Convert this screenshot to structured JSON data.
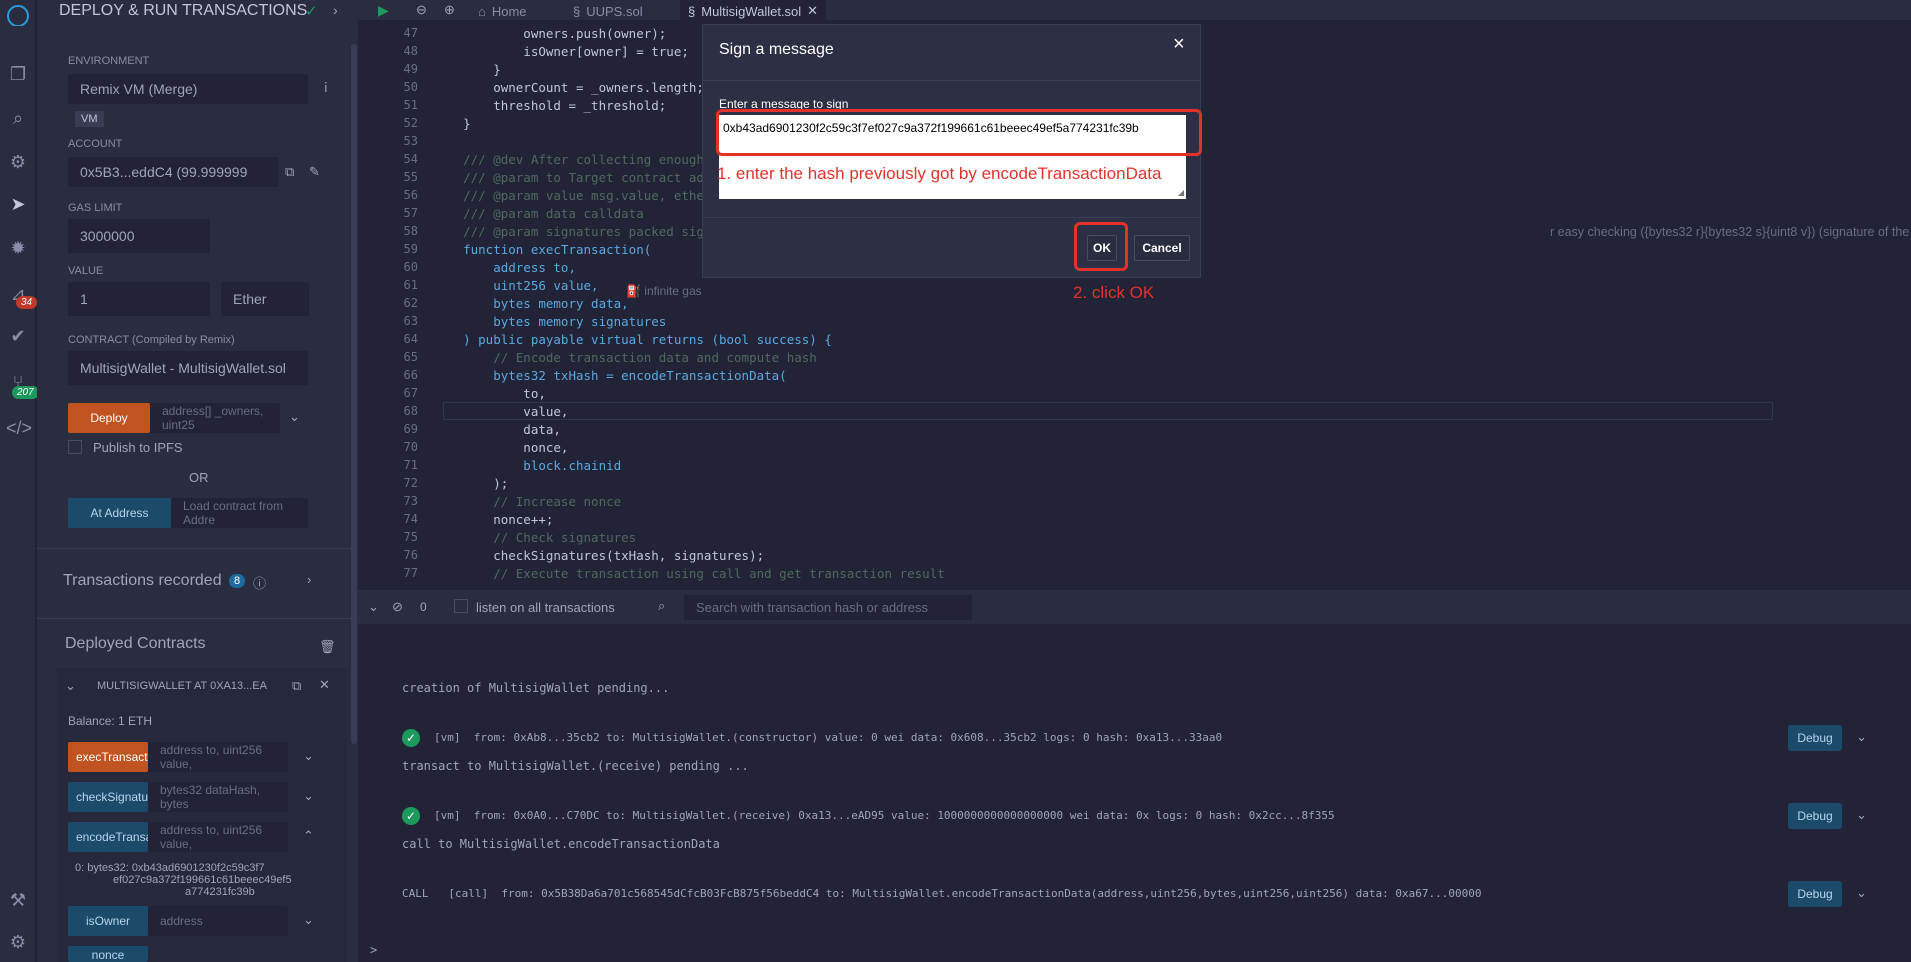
{
  "sidebar": {
    "title": "DEPLOY & RUN TRANSACTIONS",
    "badge_34": "34",
    "badge_207": "207"
  },
  "panel": {
    "environment_label": "ENVIRONMENT",
    "environment_value": "Remix VM (Merge)",
    "vm_tag": "VM",
    "account_label": "ACCOUNT",
    "account_value": "0x5B3...eddC4 (99.999999",
    "gas_limit_label": "GAS LIMIT",
    "gas_limit_value": "3000000",
    "value_label": "VALUE",
    "value_amount": "1",
    "value_unit": "Ether",
    "contract_label": "CONTRACT (Compiled by Remix)",
    "contract_value": "MultisigWallet - MultisigWallet.sol",
    "deploy_label": "Deploy",
    "deploy_params": "address[] _owners, uint25",
    "publish_ipfs": "Publish to IPFS",
    "or_text": "OR",
    "at_address_label": "At Address",
    "at_address_placeholder": "Load contract from Addre",
    "transactions_recorded": "Transactions recorded",
    "transactions_count": "8",
    "deployed_contracts": "Deployed Contracts",
    "instance_name": "MULTISIGWALLET AT 0XA13...EA",
    "balance": "Balance: 1 ETH",
    "functions": [
      {
        "name": "execTransact",
        "params": "address to, uint256 value,"
      },
      {
        "name": "checkSignatu",
        "params": "bytes32 dataHash, bytes"
      },
      {
        "name": "encodeTransa",
        "params": "address to, uint256 value,"
      }
    ],
    "output_line1": "0:  bytes32: 0xb43ad6901230f2c59c3f7",
    "output_line2": "ef027c9a372f199661c61beeec49ef5",
    "output_line3": "a774231fc39b",
    "is_owner_label": "isOwner",
    "is_owner_param": "address",
    "nonce_label": "nonce"
  },
  "tabs": {
    "home": "Home",
    "uups": "UUPS.sol",
    "multisig": "MultisigWallet.sol"
  },
  "code": [
    {
      "n": "47",
      "t": "            owners.push(owner);"
    },
    {
      "n": "48",
      "t": "            isOwner[owner] = true;"
    },
    {
      "n": "49",
      "t": "        }"
    },
    {
      "n": "50",
      "t": "        ownerCount = _owners.length;"
    },
    {
      "n": "51",
      "t": "        threshold = _threshold;"
    },
    {
      "n": "52",
      "t": "    }"
    },
    {
      "n": "53",
      "t": ""
    },
    {
      "n": "54",
      "t": "    /// @dev After collecting enough"
    },
    {
      "n": "55",
      "t": "    /// @param to Target contract ad"
    },
    {
      "n": "56",
      "t": "    /// @param value msg.value, ethe"
    },
    {
      "n": "57",
      "t": "    /// @param data calldata"
    },
    {
      "n": "58",
      "t": "    /// @param signatures packed sig"
    },
    {
      "n": "59",
      "t": "    function execTransaction("
    },
    {
      "n": "60",
      "t": "        address to,"
    },
    {
      "n": "61",
      "t": "        uint256 value,"
    },
    {
      "n": "62",
      "t": "        bytes memory data,"
    },
    {
      "n": "63",
      "t": "        bytes memory signatures"
    },
    {
      "n": "64",
      "t": "    ) public payable virtual returns (bool success) {"
    },
    {
      "n": "65",
      "t": "        // Encode transaction data and compute hash"
    },
    {
      "n": "66",
      "t": "        bytes32 txHash = encodeTransactionData("
    },
    {
      "n": "67",
      "t": "            to,"
    },
    {
      "n": "68",
      "t": "            value,"
    },
    {
      "n": "69",
      "t": "            data,"
    },
    {
      "n": "70",
      "t": "            nonce,"
    },
    {
      "n": "71",
      "t": "            block.chainid"
    },
    {
      "n": "72",
      "t": "        );"
    },
    {
      "n": "73",
      "t": "        // Increase nonce"
    },
    {
      "n": "74",
      "t": "        nonce++;"
    },
    {
      "n": "75",
      "t": "        // Check signatures"
    },
    {
      "n": "76",
      "t": "        checkSignatures(txHash, signatures);"
    },
    {
      "n": "77",
      "t": "        // Execute transaction using call and get transaction result"
    }
  ],
  "code_tail_58": "r easy checking ({bytes32 r}{bytes32 s}{uint8 v}) (signature of the first multis",
  "infinite_gas": "infinite gas",
  "terminal": {
    "count": "0",
    "listen_label": "listen on all transactions",
    "search_placeholder": "Search with transaction hash or address",
    "line1": "creation of MultisigWallet pending...",
    "tx1": "[vm]  from: 0xAb8...35cb2 to: MultisigWallet.(constructor) value: 0 wei data: 0x608...35cb2 logs: 0 hash: 0xa13...33aa0",
    "line2": "transact to MultisigWallet.(receive) pending ...",
    "tx2": "[vm]  from: 0x0A0...C70DC to: MultisigWallet.(receive) 0xa13...eAD95 value: 1000000000000000000 wei data: 0x logs: 0 hash: 0x2cc...8f355",
    "line3": "call to MultisigWallet.encodeTransactionData",
    "call": "CALL   [call]  from: 0x5B38Da6a701c568545dCfcB03FcB875f56beddC4 to: MultisigWallet.encodeTransactionData(address,uint256,bytes,uint256,uint256) data: 0xa67...00000",
    "debug_label": "Debug",
    "prompt": ">"
  },
  "modal": {
    "title": "Sign a message",
    "close": "×",
    "field_label": "Enter a message to sign",
    "message_value": "0xb43ad6901230f2c59c3f7ef027c9a372f199661c61beeec49ef5a774231fc39b",
    "ok_label": "OK",
    "cancel_label": "Cancel"
  },
  "annotations": {
    "step1": "1. enter the hash previously got by encodeTransactionData",
    "step2": "2. click OK"
  },
  "colors": {
    "accent_red": "#e4322b",
    "deploy_orange": "#c0531f",
    "success_green": "#1c9a5e"
  }
}
